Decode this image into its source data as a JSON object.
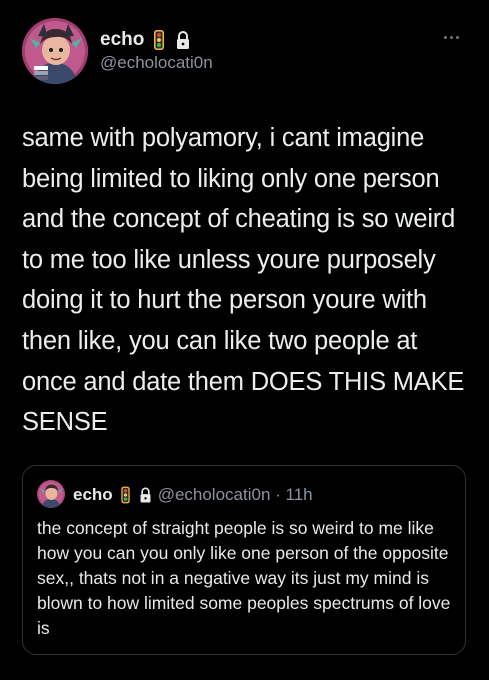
{
  "author": {
    "display_name": "echo",
    "handle": "@echolocati0n",
    "badges": [
      "traffic-light-icon",
      "lock-icon"
    ]
  },
  "tweet": {
    "text": "same with polyamory, i cant imagine being limited to liking only one person and the concept of cheating is so weird to me too like unless youre purposely doing it to hurt the person youre with then like, you can like two people at once and date them DOES THIS MAKE SENSE"
  },
  "quoted": {
    "display_name": "echo",
    "handle_time": "@echolocati0n · 11h",
    "text": "the concept of straight people is so weird to me like how you can you only like one person of the opposite sex,, thats not in a negative way its just my mind is blown to how limited some peoples spectrums of love is"
  },
  "colors": {
    "background": "#000000",
    "text": "#e7e9ea",
    "secondary": "#8b949c",
    "border": "#2f3336"
  }
}
